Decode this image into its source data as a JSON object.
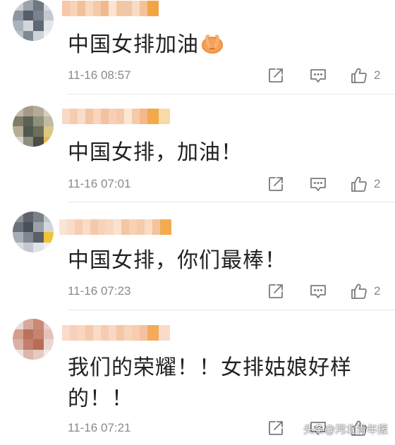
{
  "comments": [
    {
      "text": "中国女排加油",
      "has_emoji": true,
      "emoji": "pray-hands-emoji",
      "time": "11-16 08:57",
      "likes": "2",
      "username_blur": [
        "#f6c7a9",
        "#f8d3b8",
        "#f3c09c",
        "#f9d8c0",
        "#f6c9aa",
        "#f2b98f",
        "#fbe5d2",
        "#f4c7a3",
        "#f0c7a8",
        "#f8dcc2",
        "#f4c199",
        "#f3a445"
      ],
      "avatar_colors": [
        "#c9ccd1",
        "#9aa2aa",
        "#6d7681",
        "#d7dade",
        "#8d96a0",
        "#545d68",
        "#7a838d",
        "#c3c9cf",
        "#aab3bb",
        "#d2d6da",
        "#5f6873",
        "#e3e6e9",
        "#b8c0c8",
        "#7e8891",
        "#ced3d8",
        "#eceef0"
      ]
    },
    {
      "text": "中国女排，加油！",
      "has_emoji": false,
      "time": "11-16 07:01",
      "likes": "2",
      "username_blur": [
        "#f8d9c6",
        "#f7cbb0",
        "#f9ddc8",
        "#f4c4a3",
        "#f8d5bd",
        "#f3c29f",
        "#f7d0b4",
        "#f6c9a8",
        "#fbe7d6",
        "#f5caa8",
        "#f3b88b",
        "#f3a84c",
        "#f9d9a5"
      ],
      "avatar_colors": [
        "#c4b9a8",
        "#a59a89",
        "#b5aa98",
        "#d7cdbd",
        "#7f7c68",
        "#5c6257",
        "#8f917c",
        "#bfb9a5",
        "#b7ad97",
        "#4f5a4f",
        "#6d6f5a",
        "#d8c98a",
        "#d6d3c8",
        "#8e8e7d",
        "#4a4e45",
        "#f0b54a"
      ]
    },
    {
      "text": "中国女排，你们最棒！",
      "has_emoji": false,
      "time": "11-16 07:23",
      "likes": "2",
      "username_blur": [
        "#fae4d4",
        "#f8dcc7",
        "#f6ceb3",
        "#f9dcc6",
        "#f5c8a7",
        "#f7d3b8",
        "#f8d8c1",
        "#fae2cf",
        "#f4c6a3",
        "#f7d2b5",
        "#f5cba9",
        "#f9dcc2",
        "#f4c29c",
        "#f3ab52"
      ],
      "avatar_colors": [
        "#8c9198",
        "#5d636b",
        "#7a8087",
        "#c2c6cb",
        "#6a7078",
        "#4b5058",
        "#9ba1a8",
        "#d4d7da",
        "#a9aeb4",
        "#7f8890",
        "#5a6068",
        "#f0c43a",
        "#d9dcdf",
        "#c5c9ce",
        "#e1e4e7",
        "#eef0f2"
      ]
    },
    {
      "text": "我们的荣耀！！女排姑娘好样的！！",
      "has_emoji": false,
      "time": "11-16 07:21",
      "likes": "",
      "username_blur": [
        "#f9dccb",
        "#f7d1ba",
        "#f8d6c0",
        "#f5c9ab",
        "#f9dbc6",
        "#f6cdb1",
        "#f8d8c2",
        "#f4c7a7",
        "#f8d4bb",
        "#f6cdb0",
        "#f3c19f",
        "#f3aa5a",
        "#f8dcc8"
      ],
      "avatar_colors": [
        "#eadbd6",
        "#d8a99b",
        "#c98a78",
        "#e8cfc7",
        "#d49d8c",
        "#b8725e",
        "#c88270",
        "#e3c3b8",
        "#dbb1a4",
        "#c27f6c",
        "#b76c58",
        "#ecd6cf",
        "#f0e2dd",
        "#ddb6aa",
        "#e6cbc2",
        "#f4ebe8"
      ]
    }
  ],
  "watermark": "头条@河北青年报",
  "icons": {
    "share": "share-icon",
    "reply": "reply-icon",
    "like": "thumbs-up-icon"
  }
}
